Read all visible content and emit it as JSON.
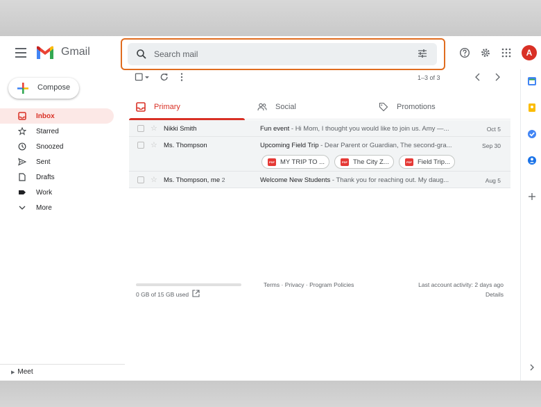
{
  "header": {
    "app_name": "Gmail",
    "search_placeholder": "Search mail",
    "avatar_initial": "A"
  },
  "sidebar": {
    "compose_label": "Compose",
    "items": [
      {
        "label": "Inbox",
        "icon": "inbox-icon",
        "active": true
      },
      {
        "label": "Starred",
        "icon": "star-icon"
      },
      {
        "label": "Snoozed",
        "icon": "clock-icon"
      },
      {
        "label": "Sent",
        "icon": "send-icon"
      },
      {
        "label": "Drafts",
        "icon": "draft-icon"
      },
      {
        "label": "Work",
        "icon": "label-icon"
      },
      {
        "label": "More",
        "icon": "chevron-down-icon"
      }
    ],
    "meet_label": "Meet"
  },
  "toolbar": {
    "pagination": "1–3 of 3"
  },
  "tabs": [
    {
      "label": "Primary",
      "icon": "inbox-icon",
      "active": true
    },
    {
      "label": "Social",
      "icon": "people-icon"
    },
    {
      "label": "Promotions",
      "icon": "tag-icon"
    }
  ],
  "emails": [
    {
      "sender": "Nikki Smith",
      "count": "",
      "subject": "Fun event",
      "snippet": " - Hi Mom, I thought you would like to join us. Amy —...",
      "date": "Oct 5"
    },
    {
      "sender": "Ms. Thompson",
      "count": "",
      "subject": "Upcoming Field Trip",
      "snippet": " - Dear Parent or Guardian, The second-gra...",
      "date": "Sep 30",
      "attachments": [
        "MY TRIP TO ...",
        "The City Z...",
        "Field Trip..."
      ]
    },
    {
      "sender": "Ms. Thompson, me",
      "count": "2",
      "subject": "Welcome New Students",
      "snippet": " - Thank you for reaching out. My daug...",
      "date": "Aug 5"
    }
  ],
  "footer": {
    "storage": "0 GB of 15 GB used",
    "storage_fraction": 0.0,
    "links": "Terms · Privacy · Program Policies",
    "last_activity": "Last account activity: 2 days ago",
    "details": "Details"
  },
  "colors": {
    "accent_red": "#d93025",
    "highlight_orange": "#e06c1f"
  }
}
